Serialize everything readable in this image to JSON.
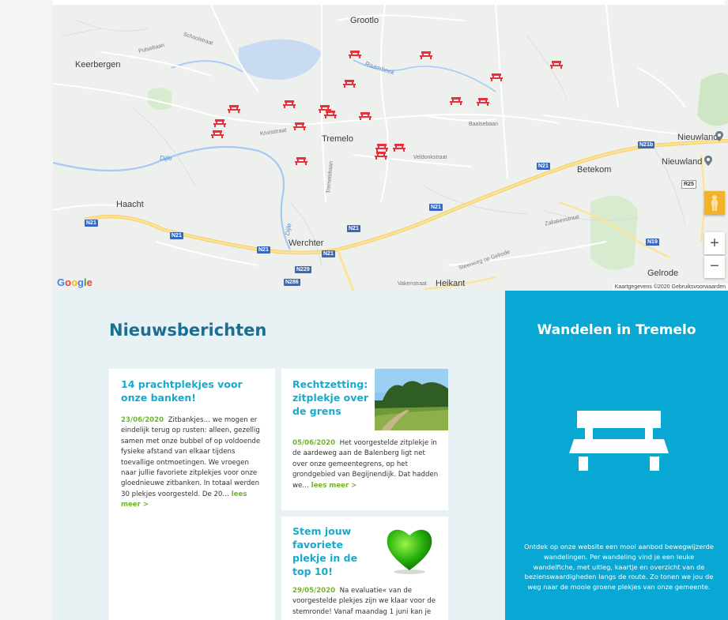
{
  "map": {
    "towns": [
      "Grootlo",
      "Keerbergen",
      "Tremelo",
      "Betekom",
      "Haacht",
      "Werchter",
      "Heikant",
      "Gelrode",
      "Nieuwland"
    ],
    "small_labels": [
      "Raambeek",
      "Kruisstraat",
      "Veldonkstraat",
      "Dijle",
      "Tremelobaan",
      "Baalsebaan",
      "Zallakenstraat",
      "Steenweg op Gelrode",
      "Vakenstraat",
      "Schoolstraat",
      "Putsebaan",
      "Dijle"
    ],
    "shields": [
      "N21",
      "N21",
      "N21",
      "N21",
      "N21",
      "N21",
      "N229",
      "N286",
      "N21b",
      "N19",
      "R25"
    ],
    "logo": "Google",
    "attribution": "Kaartgegevens ©2020   Gebruiksvoorwaarden",
    "zoom_in": "+",
    "zoom_out": "−",
    "pegman_icon": "pegman-icon",
    "bench_marker_icon": "bench-marker-icon",
    "place_pin_icon": "place-pin-icon",
    "marker_color": "#e8313a"
  },
  "news": {
    "title": "Nieuwsberichten",
    "articles": [
      {
        "title": "14 prachtplekjes voor onze banken!",
        "date": "23/06/2020",
        "text": "Zitbankjes… we mogen er eindelijk terug op rusten: alleen, gezellig samen met onze bubbel of op voldoende fysieke afstand van elkaar tijdens toevallige ontmoetingen. We vroegen naar jullie favoriete zitplekjes voor onze gloednieuwe zitbanken. In totaal werden 30 plekjes voorgesteld. De 20…",
        "more": "lees meer >"
      },
      {
        "title": "Rechtzetting: zitplekje over de grens",
        "date": "05/06/2020",
        "text": "Het voorgestelde zitplekje in de aardeweg aan de Balenberg ligt net over onze gemeentegrens, op het grondgebied van Begijnendijk. Dat hadden we…",
        "more": "lees meer >"
      },
      {
        "title": "Stem jouw favoriete plekje in de top 10!",
        "date": "29/05/2020",
        "text": "Na evaluatie« van de voorgestelde plekjes zijn we klaar voor de stemronde! Vanaf maandag 1 juni kan je",
        "more": ""
      }
    ]
  },
  "walk": {
    "title": "Wandelen in Tremelo",
    "icon": "bench-icon",
    "text": "Ontdek op onze website een mooi aanbod bewegwijzerde wandelingen. Per wandeling vind je een leuke wandelfiche, met uitleg, kaartje en overzicht van de bezienswaardigheden langs de route. Zo tonen we jou de weg naar de mooie groene plekjes van onze gemeente."
  },
  "colors": {
    "news_title": "#1a6f92",
    "card_title": "#19a9cc",
    "accent_green": "#74b22e",
    "walk_bg": "#09a7d3"
  }
}
